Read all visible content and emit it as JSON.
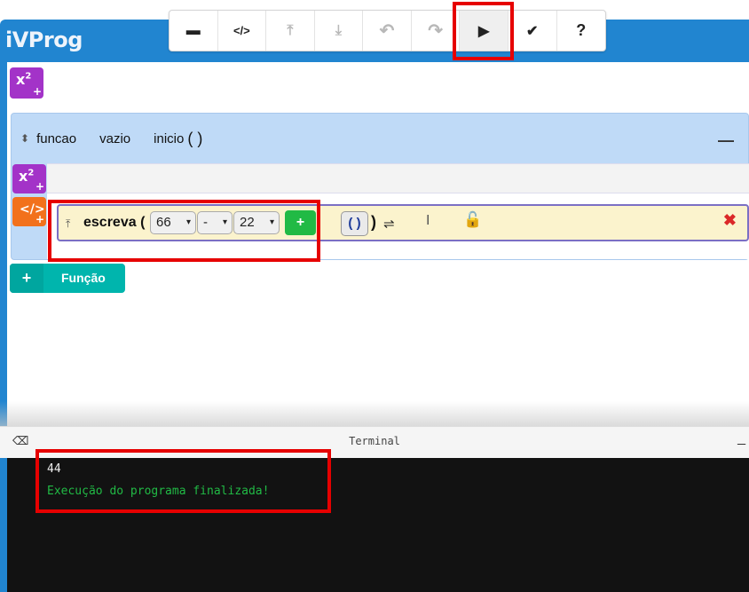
{
  "app": {
    "title": "iVProg"
  },
  "toolbar": {
    "buttons": [
      {
        "name": "visual-mode",
        "icon": "window-icon",
        "glyph": "▬",
        "disabled": false
      },
      {
        "name": "code-mode",
        "icon": "code-icon",
        "glyph": "</>",
        "disabled": false
      },
      {
        "name": "upload",
        "icon": "upload-icon",
        "glyph": "⤒",
        "disabled": true
      },
      {
        "name": "download",
        "icon": "download-icon",
        "glyph": "⤓",
        "disabled": true
      },
      {
        "name": "undo",
        "icon": "undo-icon",
        "glyph": "↶",
        "disabled": true
      },
      {
        "name": "redo",
        "icon": "redo-icon",
        "glyph": "↷",
        "disabled": true
      },
      {
        "name": "run",
        "icon": "play-icon",
        "glyph": "▶",
        "disabled": false
      },
      {
        "name": "check",
        "icon": "check-icon",
        "glyph": "✔",
        "disabled": false
      },
      {
        "name": "help",
        "icon": "help-icon",
        "glyph": "?",
        "disabled": false
      }
    ]
  },
  "globals": {
    "add_var_label": "x²",
    "plus": "+"
  },
  "function": {
    "name": "funcao",
    "type": "vazio",
    "id": "inicio",
    "params": "( )",
    "collapse": "—",
    "add_var_label": "x²",
    "add_cmd_label": "</>",
    "plus": "+"
  },
  "command": {
    "keyword": "escreva (",
    "operand1": "66",
    "operator": "-",
    "operand2": "22",
    "caret": "▾",
    "add_glyph": "+",
    "paren_btn": "( )",
    "paren_close": ")",
    "newline_glyph": "⇌",
    "cursor_glyph": "I",
    "lock_glyph": "🔓",
    "remove_glyph": "✖",
    "up_glyph": "⤒"
  },
  "add_function": {
    "plus": "+",
    "label": "Função"
  },
  "terminal": {
    "title": "Terminal",
    "eraser_glyph": "⌫",
    "minimize": "_",
    "output": "44",
    "message": "Execução do programa finalizada!",
    "message_color": "#21ba45"
  },
  "colors": {
    "brand": "#2185d0",
    "highlight": "#e60000"
  }
}
